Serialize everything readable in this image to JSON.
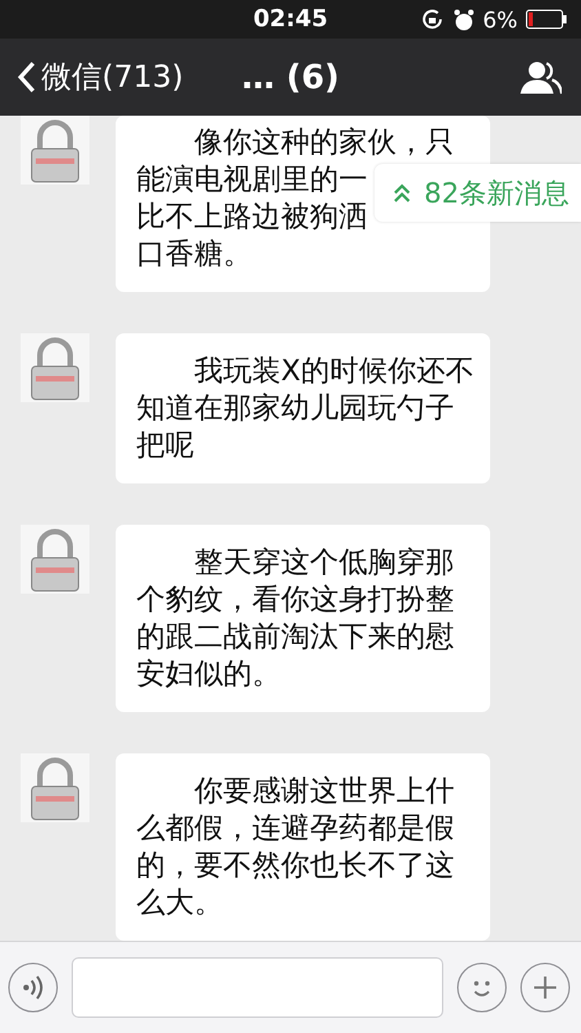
{
  "status_bar": {
    "time": "02:45",
    "battery_percent": "6%"
  },
  "nav_bar": {
    "back_label": "微信(713)",
    "title": "… (6)"
  },
  "new_messages_badge": {
    "label": "82条新消息"
  },
  "messages": [
    {
      "lines": [
        "像你这种的家伙，只",
        "能演电视剧里的一",
        "比不上路边被狗洒",
        "口香糖。"
      ]
    },
    {
      "lines": [
        "我玩装X的时候你还不",
        "知道在那家幼儿园玩勺子",
        "把呢"
      ]
    },
    {
      "lines": [
        "整天穿这个低胸穿那",
        "个豹纹，看你这身打扮整",
        "的跟二战前淘汰下来的慰",
        "安妇似的。"
      ]
    },
    {
      "lines": [
        "你要感谢这世界上什",
        "么都假，连避孕药都是假",
        "的，要不然你也长不了这",
        "么大。"
      ]
    }
  ]
}
